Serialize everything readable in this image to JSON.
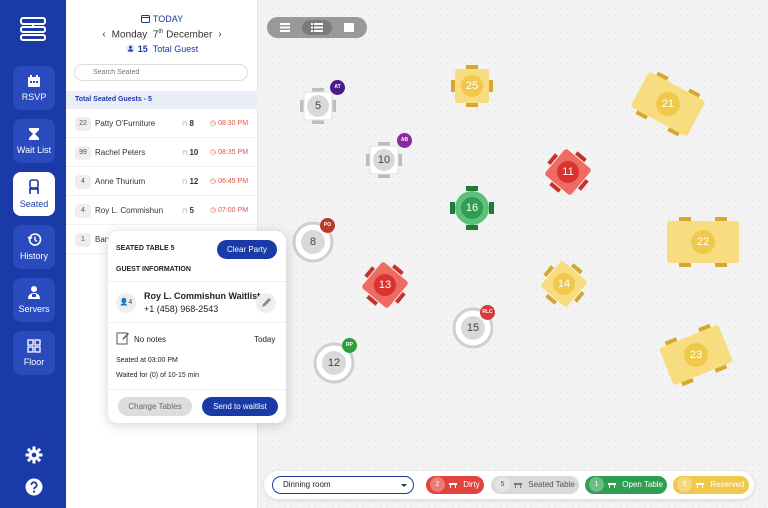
{
  "nav": {
    "items": [
      {
        "label": "RSVP",
        "icon": "calendar-icon"
      },
      {
        "label": "Wait List",
        "icon": "hourglass-icon"
      },
      {
        "label": "Seated",
        "icon": "chair-icon",
        "active": true
      },
      {
        "label": "History",
        "icon": "history-icon"
      },
      {
        "label": "Servers",
        "icon": "server-person-icon"
      },
      {
        "label": "Floor",
        "icon": "floor-grid-icon"
      }
    ]
  },
  "panel": {
    "today_label": "TODAY",
    "day": "Monday",
    "date_num": "7",
    "date_suffix": "th",
    "month": "December",
    "guest_count": "15",
    "guest_label": "Total Guest",
    "search_placeholder": "Search Seated",
    "section_title": "Total Seated Guests - 5",
    "rows": [
      {
        "size": "22",
        "name": "Patty O'Furniture",
        "table": "8",
        "time": "08:30 PM"
      },
      {
        "size": "99",
        "name": "Rachel Peters",
        "table": "10",
        "time": "08:35 PM"
      },
      {
        "size": "4",
        "name": "Anne Thurium",
        "table": "12",
        "time": "06:45 PM"
      },
      {
        "size": "4",
        "name": "Roy L. Commishun",
        "table": "5",
        "time": "07:00 PM"
      },
      {
        "size": "1",
        "name": "Barr",
        "table": "",
        "time": ""
      }
    ]
  },
  "popup": {
    "title": "SEATED TABLE 5",
    "clear_label": "Clear Party",
    "guest_info_label": "GUEST INFORMATION",
    "party_size": "4",
    "guest_name": "Roy L. Commishun Waitlist",
    "phone": "+1 (458) 968-2543",
    "notes": "No notes",
    "notes_date": "Today",
    "seated_at": "Seated at 03:00 PM",
    "waited_for": "Waited for (0) of 10-15 min",
    "change_label": "Change Tables",
    "send_label": "Send to waitlist"
  },
  "tables": [
    {
      "num": "5",
      "status": "seated",
      "badge": "AT",
      "badge_color": "#4b1a8c"
    },
    {
      "num": "10",
      "status": "seated",
      "badge": "AB",
      "badge_color": "#8a2aa0"
    },
    {
      "num": "8",
      "status": "seated",
      "badge": "PO",
      "badge_color": "#b83a2a"
    },
    {
      "num": "12",
      "status": "seated",
      "badge": "RP",
      "badge_color": "#2f9e3a"
    },
    {
      "num": "15",
      "status": "seated",
      "badge": "RLC",
      "badge_color": "#d43a3a"
    },
    {
      "num": "13",
      "status": "dirty",
      "badge": "",
      "badge_color": ""
    },
    {
      "num": "11",
      "status": "dirty",
      "badge": "",
      "badge_color": ""
    },
    {
      "num": "16",
      "status": "open",
      "badge": "",
      "badge_color": ""
    },
    {
      "num": "25",
      "status": "reserved",
      "badge": "",
      "badge_color": ""
    },
    {
      "num": "21",
      "status": "reserved",
      "badge": "",
      "badge_color": ""
    },
    {
      "num": "14",
      "status": "reserved",
      "badge": "",
      "badge_color": ""
    },
    {
      "num": "22",
      "status": "reserved",
      "badge": "",
      "badge_color": ""
    },
    {
      "num": "23",
      "status": "reserved",
      "badge": "",
      "badge_color": ""
    }
  ],
  "bottom": {
    "room": "Dinning room",
    "legend": [
      {
        "count": "2",
        "label": "Dirty",
        "color": "#e0443c"
      },
      {
        "count": "5",
        "label": "Seated Table",
        "color": "#d9d9d9"
      },
      {
        "count": "1",
        "label": "Open Table",
        "color": "#2f9e52"
      },
      {
        "count": "5",
        "label": "Reserved",
        "color": "#f0c84a"
      }
    ]
  },
  "colors": {
    "brand": "#1a3aa8",
    "dirty": "#e0443c",
    "open": "#2f9e52",
    "reserved": "#f0c84a",
    "seated": "#d9d9d9"
  }
}
